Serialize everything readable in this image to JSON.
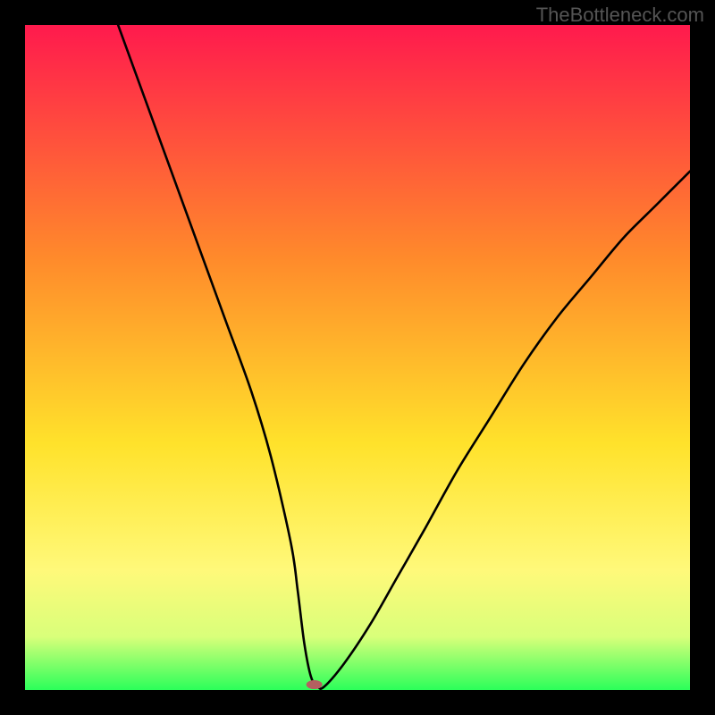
{
  "watermark": "TheBottleneck.com",
  "chart_data": {
    "type": "line",
    "title": "",
    "xlabel": "",
    "ylabel": "",
    "xlim": [
      0,
      100
    ],
    "ylim": [
      0,
      100
    ],
    "grid": false,
    "legend": false,
    "series": [
      {
        "name": "curve",
        "x": [
          14,
          18,
          22,
          26,
          30,
          34,
          37,
          40,
          41,
          42,
          43,
          44,
          45,
          48,
          52,
          56,
          60,
          65,
          70,
          75,
          80,
          85,
          90,
          95,
          100
        ],
        "y": [
          100,
          89,
          78,
          67,
          56,
          45,
          35,
          22,
          15,
          7,
          2,
          0.5,
          0.5,
          4,
          10,
          17,
          24,
          33,
          41,
          49,
          56,
          62,
          68,
          73,
          78
        ]
      }
    ],
    "green_band": {
      "y_start": 0,
      "y_end": 3
    },
    "marker": {
      "x": 43.5,
      "y": 0.8,
      "color": "#b46060"
    },
    "gradient_stops": [
      {
        "offset": 0.0,
        "color": "#ff1a4d"
      },
      {
        "offset": 0.35,
        "color": "#ff8a2b"
      },
      {
        "offset": 0.63,
        "color": "#ffe22b"
      },
      {
        "offset": 0.82,
        "color": "#fff97a"
      },
      {
        "offset": 0.92,
        "color": "#d9ff7a"
      },
      {
        "offset": 1.0,
        "color": "#2bff5a"
      }
    ]
  }
}
